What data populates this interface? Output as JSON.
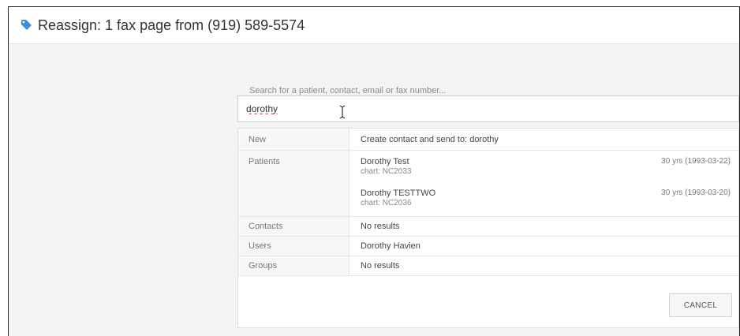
{
  "header": {
    "title": "Reassign: 1 fax page from (919) 589-5574",
    "icon": "tag-icon",
    "icon_color": "#3b8fd6"
  },
  "search": {
    "placeholder": "Search for a patient, contact, email or fax number...",
    "value": "dorothy"
  },
  "results": {
    "new": {
      "category": "New",
      "text": "Create contact and send to: dorothy"
    },
    "patients": {
      "category": "Patients",
      "items": [
        {
          "name": "Dorothy Test",
          "chart": "chart: NC2033",
          "age": "30 yrs (1993-03-22)"
        },
        {
          "name": "Dorothy TESTTWO",
          "chart": "chart: NC2036",
          "age": "30 yrs (1993-03-20)"
        }
      ]
    },
    "contacts": {
      "category": "Contacts",
      "text": "No results"
    },
    "users": {
      "category": "Users",
      "text": "Dorothy Havien"
    },
    "groups": {
      "category": "Groups",
      "text": "No results"
    }
  },
  "footer": {
    "cancel_label": "CANCEL"
  }
}
